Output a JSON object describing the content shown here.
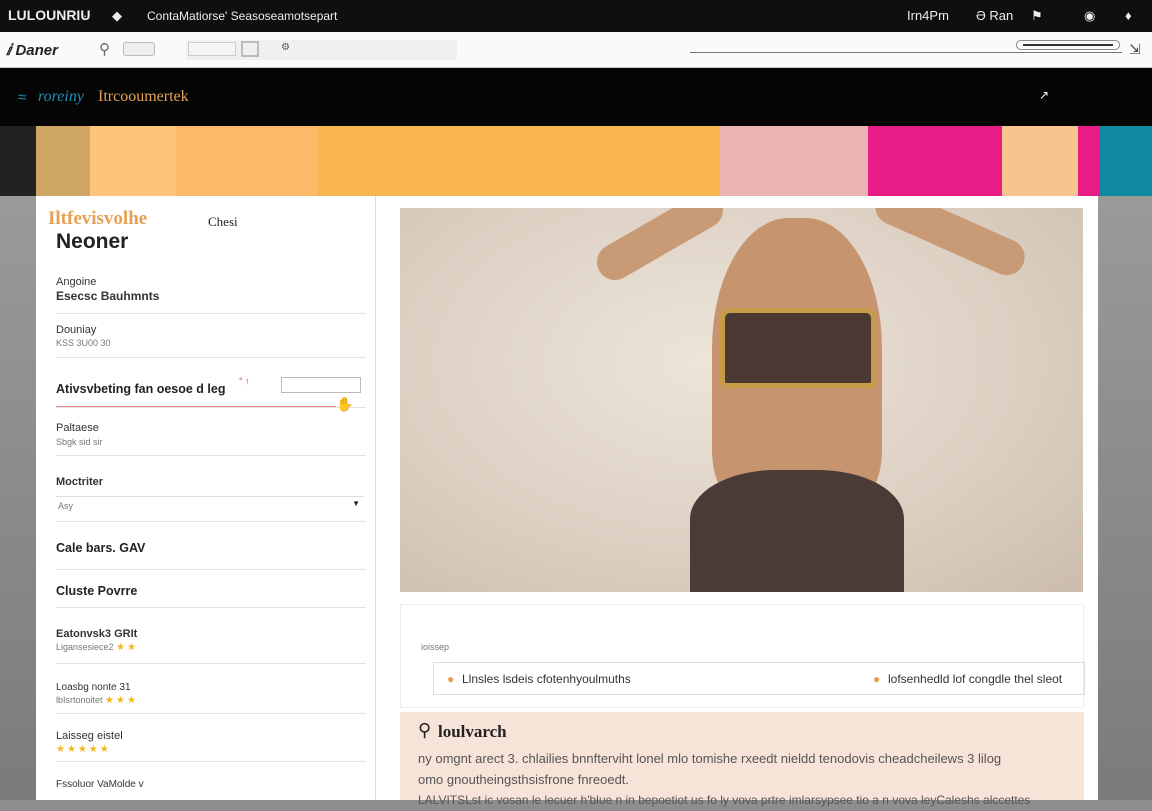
{
  "sysbar": {
    "app_name": "LULOUNRIU",
    "breadcrumb": "ContaMatiorse' Seasoseamotsepart",
    "time": "Irn4Pm",
    "status": "Ə Ran"
  },
  "toolbar": {
    "logo": "Daner"
  },
  "navbar": {
    "link1": "roreiny",
    "link2": "Itrcooumertek",
    "arrow": "↗"
  },
  "banner": {
    "colors": [
      "#cfa665",
      "#fdc57a",
      "#fcb968",
      "#f8b54f",
      "#e9b4b3",
      "#e81c86",
      "#f6c58e",
      "#0f8aa0"
    ]
  },
  "sidebar": {
    "brand": "Iltfevisvolhe",
    "brand_tag": "Chesi",
    "title": "Neoner",
    "items": [
      {
        "label": "Angoine",
        "value": "Esecsc Bauhmnts"
      },
      {
        "label": "Douniay",
        "value": "KSS 3U00 30"
      },
      {
        "label": "Ativsvbeting fan oesoe d leg",
        "value": ""
      },
      {
        "label": "Paltaese",
        "value": "Sbgk sid sir"
      },
      {
        "label": "Moctriter",
        "value": "Asy"
      },
      {
        "label": "Cale bars. GAV",
        "value": ""
      },
      {
        "label": "Cluste Povrre",
        "value": ""
      },
      {
        "label": "Eatonvsk3 GRIt",
        "value": "Ligansesiece2"
      },
      {
        "label": "Loasbg nonte 31",
        "value": "lbIsrtonoitet"
      },
      {
        "label": "Laisseg eistel",
        "value": ""
      },
      {
        "label": "Fssoluor VaMolde v",
        "value": ""
      }
    ]
  },
  "main": {
    "tag": "ioissep",
    "highlight_left": "Llnsles lsdeis  cfotenhyoulmuths",
    "highlight_right": "lofsenhedld lof congdle thel sleot",
    "section_title": "loulvarch",
    "paragraph1": "ny  omgnt arect 3.  chlailies bnnfterviht lonel mlo tomishe rxeedt nieldd tenodovis cheadcheilews 3 lilog",
    "paragraph2": "omo gnoutheingsthsisfrone fnreoedt.",
    "paragraph3": "LALVITSLst ic vosan le lecuer h'blue n in bepoetiot us fo ly vova prtre imlarsypsee tio a n vova leyCaleshs alccettes"
  }
}
